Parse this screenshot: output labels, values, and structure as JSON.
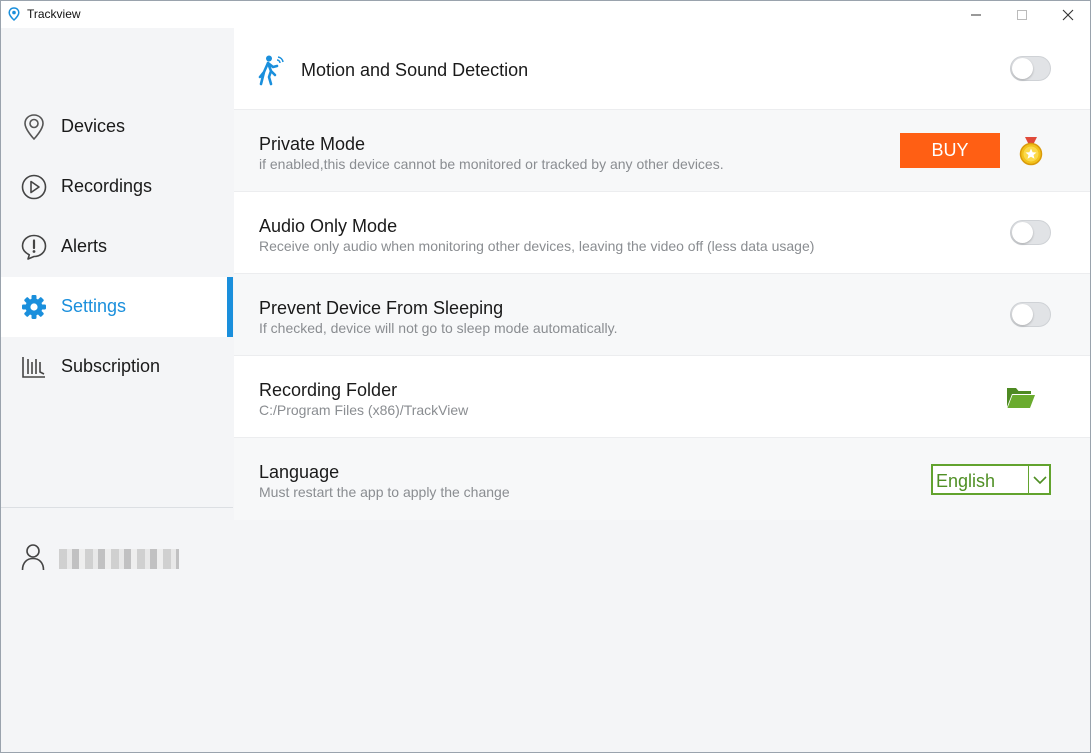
{
  "window": {
    "title": "Trackview",
    "minimize_icon": "minimize-icon",
    "maximize_icon": "maximize-icon",
    "close_icon": "close-icon"
  },
  "colors": {
    "accent": "#1a8fdc",
    "buy_button": "#ff5f14",
    "language_green": "#62a32e",
    "folder_green": "#5a9b2a"
  },
  "sidebar": {
    "items": [
      {
        "label": "Devices",
        "icon": "location-pin-icon",
        "active": false
      },
      {
        "label": "Recordings",
        "icon": "play-circle-icon",
        "active": false
      },
      {
        "label": "Alerts",
        "icon": "alert-icon",
        "active": false
      },
      {
        "label": "Settings",
        "icon": "gear-icon",
        "active": true
      },
      {
        "label": "Subscription",
        "icon": "subscription-icon",
        "active": false
      }
    ],
    "user": {
      "icon": "user-icon"
    }
  },
  "settings": {
    "motion": {
      "title": "Motion and Sound Detection",
      "icon": "walking-person-icon",
      "enabled": false
    },
    "private_mode": {
      "title": "Private Mode",
      "subtitle": "if enabled,this device cannot be monitored or tracked by any other devices.",
      "buy_label": "BUY",
      "medal_icon": "medal-icon"
    },
    "audio_only": {
      "title": "Audio Only Mode",
      "subtitle": "Receive only audio when monitoring other devices, leaving the video off (less data usage)",
      "enabled": false
    },
    "prevent_sleep": {
      "title": "Prevent Device From Sleeping",
      "subtitle": "If checked, device will not go to sleep mode automatically.",
      "enabled": false
    },
    "recording_folder": {
      "title": "Recording Folder",
      "path": "C:/Program Files (x86)/TrackView",
      "folder_icon": "folder-open-icon"
    },
    "language": {
      "title": "Language",
      "subtitle": "Must restart the app to apply the change",
      "selected": "English"
    }
  }
}
